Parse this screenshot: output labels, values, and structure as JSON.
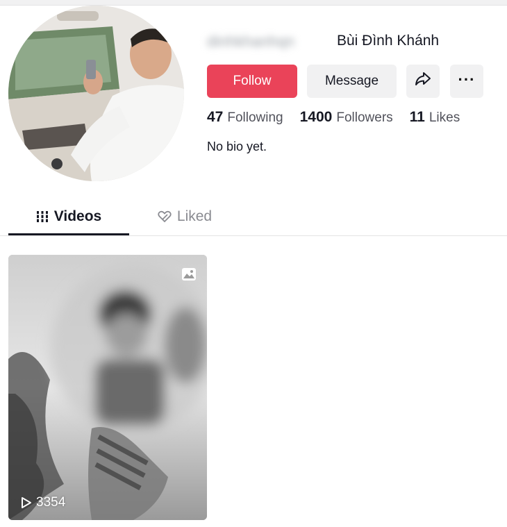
{
  "profile": {
    "username": "dinhkhanhqn",
    "display_name": "Bùi Đình Khánh",
    "bio": "No bio yet."
  },
  "actions": {
    "follow_label": "Follow",
    "message_label": "Message",
    "share_icon": "share-arrow-icon",
    "more_icon": "more-dots-icon",
    "more_label": "···"
  },
  "stats": {
    "following": {
      "count": "47",
      "label": "Following"
    },
    "followers": {
      "count": "1400",
      "label": "Followers"
    },
    "likes": {
      "count": "11",
      "label": "Likes"
    }
  },
  "tabs": [
    {
      "label": "Videos",
      "icon": "grid-icon",
      "active": true
    },
    {
      "label": "Liked",
      "icon": "liked-heart-icon",
      "active": false
    }
  ],
  "videos": [
    {
      "views": "3354",
      "type_icon": "photo-icon",
      "play_icon": "play-icon"
    }
  ],
  "colors": {
    "follow_button": "#ea4359",
    "secondary_button": "#f1f1f2",
    "text_primary": "#161823",
    "text_secondary": "#51525b"
  }
}
